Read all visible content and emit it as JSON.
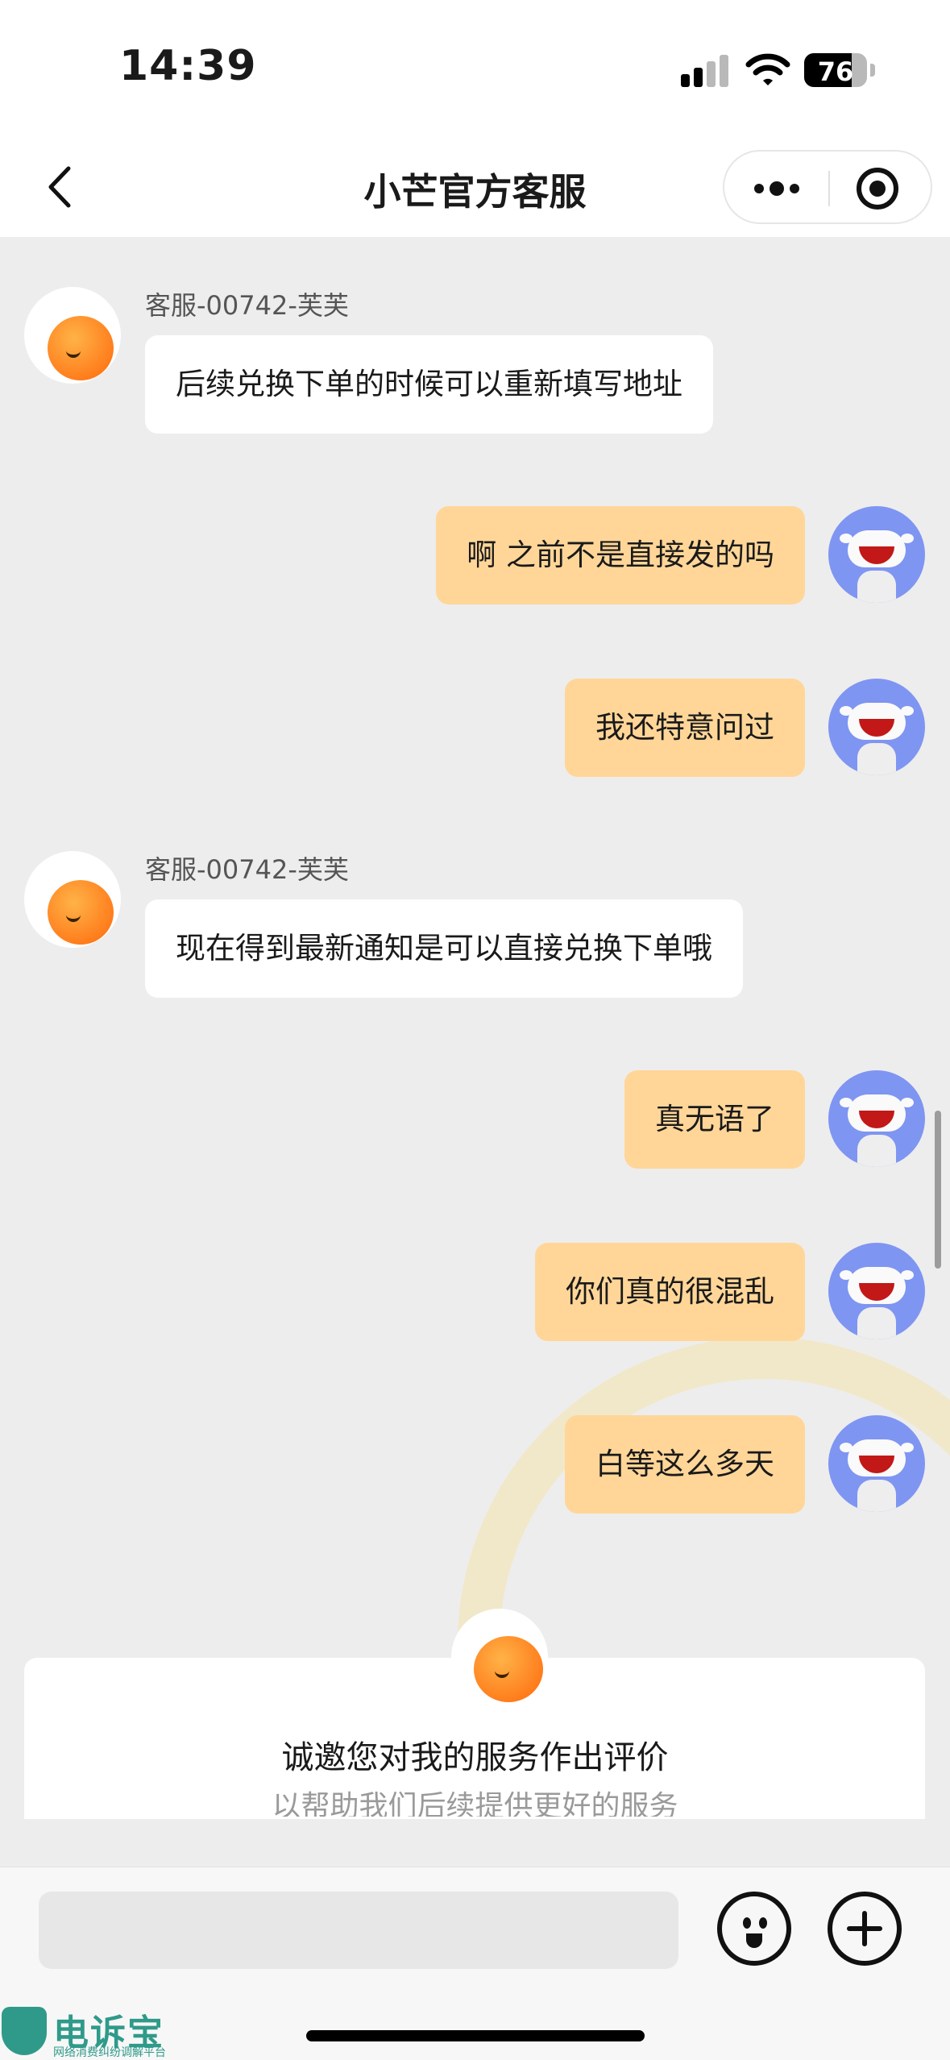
{
  "status_bar": {
    "time": "14:39",
    "battery": "76",
    "battery_level": 0.76
  },
  "nav": {
    "title": "小芒官方客服"
  },
  "messages": [
    {
      "side": "agent",
      "sender": "客服-00742-芙芙",
      "text": "后续兑换下单的时候可以重新填写地址"
    },
    {
      "side": "user",
      "text": "啊 之前不是直接发的吗"
    },
    {
      "side": "user",
      "text": "我还特意问过"
    },
    {
      "side": "agent",
      "sender": "客服-00742-芙芙",
      "text": "现在得到最新通知是可以直接兑换下单哦"
    },
    {
      "side": "user",
      "text": "真无语了"
    },
    {
      "side": "user",
      "text": "你们真的很混乱"
    },
    {
      "side": "user",
      "text": "白等这么多天"
    }
  ],
  "rating": {
    "title": "诚邀您对我的服务作出评价",
    "subtitle": "以帮助我们后续提供更好的服务"
  },
  "input": {
    "value": "",
    "placeholder": ""
  },
  "watermark": {
    "name": "电诉宝",
    "tagline": "网络消费纠纷调解平台"
  },
  "colors": {
    "user_bubble": "#ffd698",
    "agent_bubble": "#ffffff",
    "background": "#ededed",
    "user_avatar": "#7f95f2",
    "agent_ball": "#ff8a22"
  }
}
